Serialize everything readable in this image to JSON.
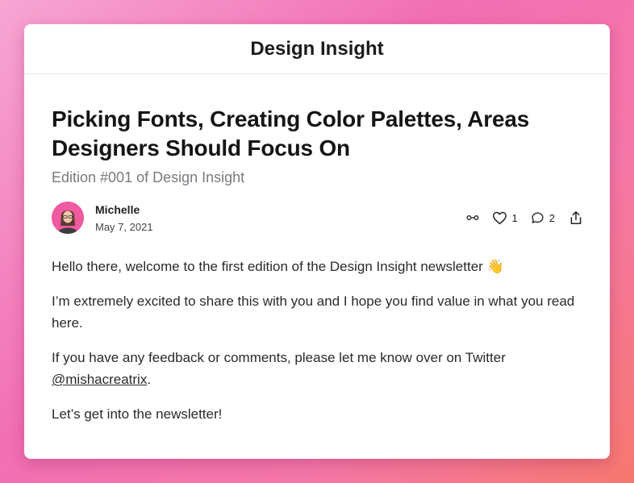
{
  "publication": {
    "title": "Design Insight"
  },
  "post": {
    "title": "Picking Fonts, Creating Color Palettes, Areas Designers Should Focus On",
    "subtitle": "Edition #001 of Design Insight",
    "author": "Michelle",
    "date": "May 7, 2021",
    "likes": "1",
    "comments": "2",
    "body": {
      "p1": "Hello there, welcome to the first edition of the Design Insight newsletter 👋",
      "p2": "I’m extremely excited to share this with you and I hope you find value in what you read here.",
      "p3_prefix": "If you have any feedback or comments, please let me know over on Twitter ",
      "twitter_handle": "@mishacreatrix",
      "p3_suffix": ".",
      "p4": "Let’s get into the newsletter!"
    }
  },
  "icons": {
    "link": "link-icon",
    "like": "heart-icon",
    "comment": "comment-icon",
    "share": "share-icon"
  },
  "colors": {
    "background_gradient": [
      "#f7a6d3",
      "#f26fb4",
      "#f7786e"
    ],
    "card": "#ffffff",
    "text": "#2a2a2e",
    "subtitle": "#7a7a80",
    "avatar_bg": "#f05aa0"
  }
}
